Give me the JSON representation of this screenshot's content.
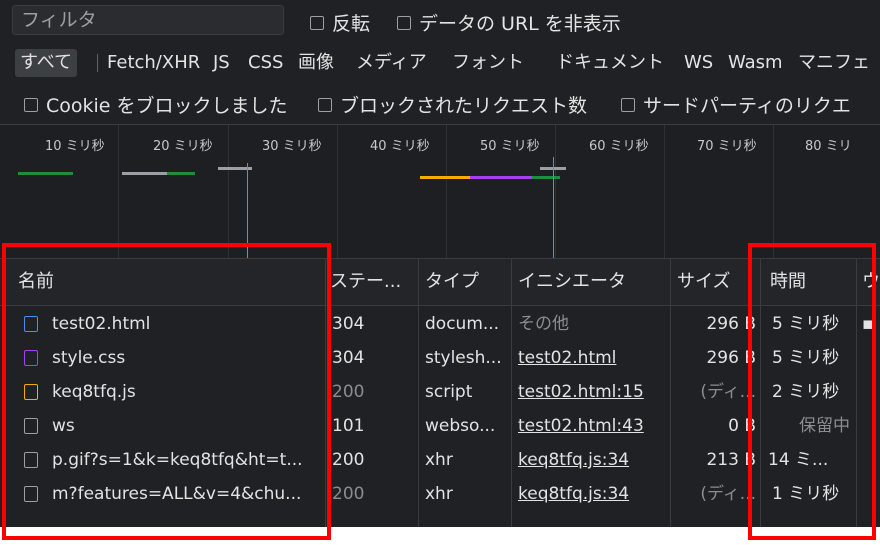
{
  "filter": {
    "placeholder": "フィルタ",
    "invert_label": "反転",
    "hide_data_urls_label": "データの URL を非表示"
  },
  "types": [
    "すべて",
    "Fetch/XHR",
    "JS",
    "CSS",
    "画像",
    "メディア",
    "フォント",
    "ドキュメント",
    "WS",
    "Wasm",
    "マニフェ"
  ],
  "blocked": {
    "blocked_cookies_label": "Cookie をブロックしました",
    "blocked_requests_label": "ブロックされたリクエスト数",
    "third_party_label": "サードパーティのリクエ"
  },
  "overview": {
    "labels": [
      "10 ミリ秒",
      "20 ミリ秒",
      "30 ミリ秒",
      "40 ミリ秒",
      "50 ミリ秒",
      "60 ミリ秒",
      "70 ミリ秒",
      "80 ミリ"
    ]
  },
  "columns": [
    "名前",
    "ステー...",
    "タイプ",
    "イニシエータ",
    "サイズ",
    "時間",
    "ウ"
  ],
  "rows": [
    {
      "icon": "document-icon",
      "name": "test02.html",
      "status": "304",
      "type": "docum...",
      "initiator": "その他",
      "size": "296 B",
      "time": "5 ミリ秒",
      "waterfall": "▪"
    },
    {
      "icon": "stylesheet-icon",
      "name": "style.css",
      "status": "304",
      "type": "stylesh...",
      "initiator": "test02.html",
      "size": "296 B",
      "time": "5 ミリ秒"
    },
    {
      "icon": "script-icon",
      "name": "keq8tfq.js",
      "status": "200",
      "type": "script",
      "initiator": "test02.html:15",
      "size": "(ディ...",
      "time": "2 ミリ秒"
    },
    {
      "icon": "websocket-icon",
      "name": "ws",
      "status": "101",
      "type": "webso...",
      "initiator": "test02.html:43",
      "size": "0 B",
      "time": "保留中"
    },
    {
      "icon": "xhr-icon",
      "name": "p.gif?s=1&k=keq8tfq&ht=t...",
      "status": "200",
      "type": "xhr",
      "initiator": "keq8tfq.js:34",
      "size": "213 B",
      "time": "14 ミ..."
    },
    {
      "icon": "xhr-icon",
      "name": "m?features=ALL&v=4&chu...",
      "status": "200",
      "type": "xhr",
      "initiator": "keq8tfq.js:34",
      "size": "(ディ...",
      "time": "1 ミリ秒"
    }
  ],
  "colors": {
    "highlight": "#ff0000",
    "background": "#202124",
    "doc_icon": "#4c8bf5",
    "css_icon": "#a142f4",
    "js_icon": "#f9ab00"
  }
}
